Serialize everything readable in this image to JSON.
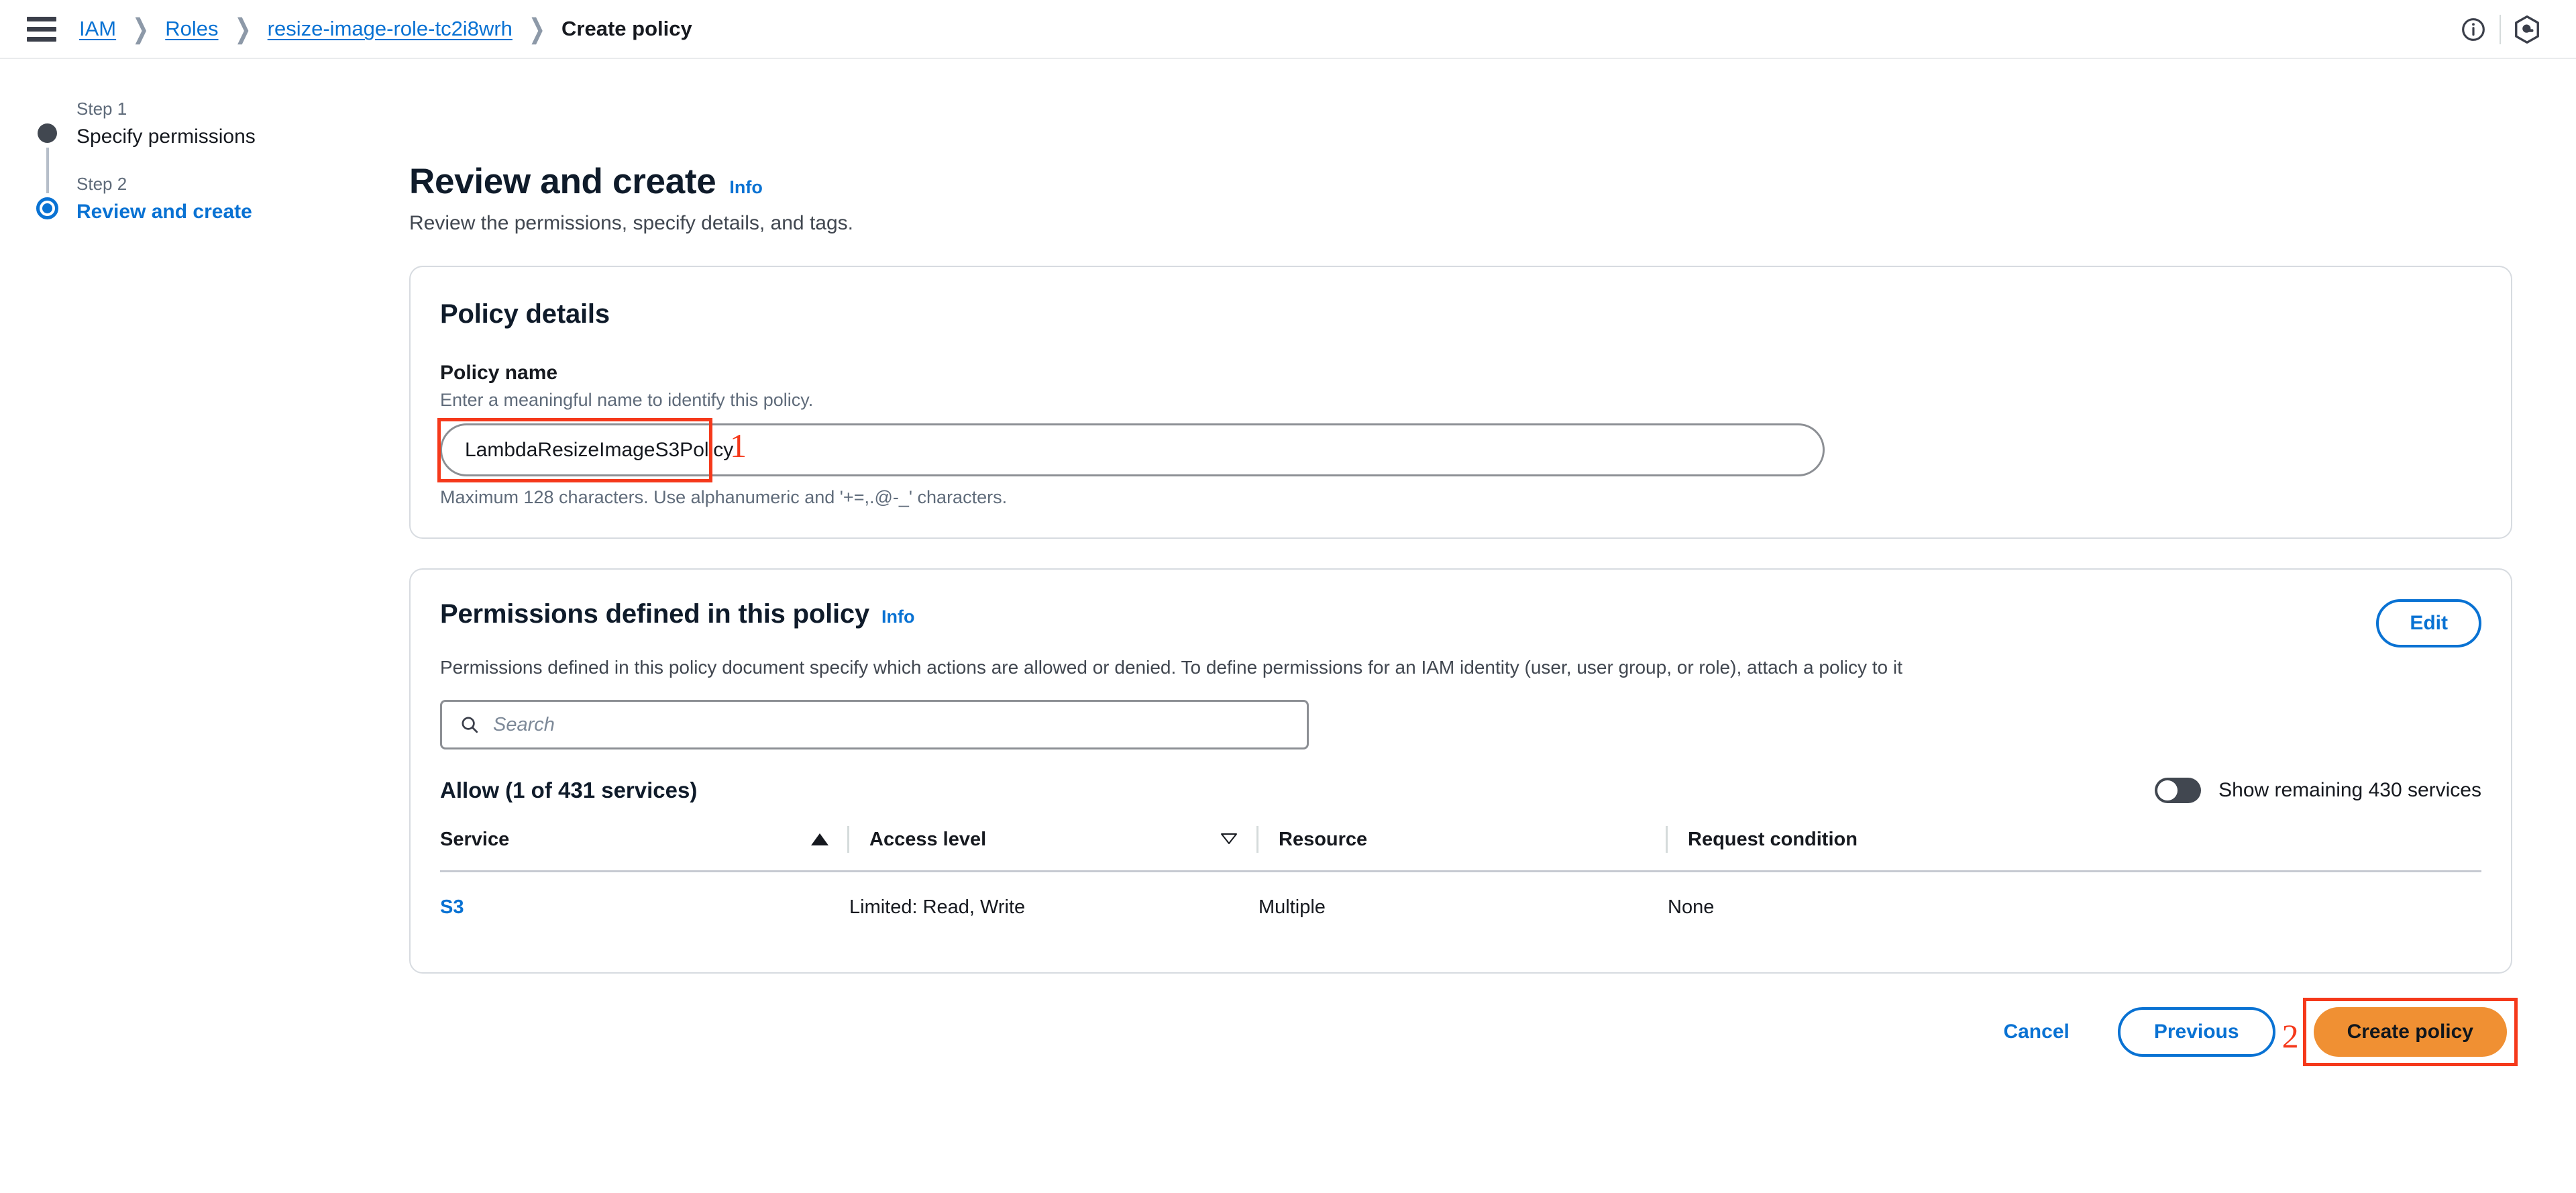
{
  "topbar": {
    "menu_icon": "hamburger-menu-icon",
    "breadcrumb": [
      {
        "label": "IAM",
        "type": "link"
      },
      {
        "label": "Roles",
        "type": "link"
      },
      {
        "label": "resize-image-role-tc2i8wrh",
        "type": "link"
      },
      {
        "label": "Create policy",
        "type": "current"
      }
    ],
    "separator": "❯",
    "info_icon": "info-circle-icon",
    "settings_icon": "aws-q-hexagon-icon"
  },
  "wizard": {
    "steps": [
      {
        "step_label": "Step 1",
        "title": "Specify permissions",
        "state": "done"
      },
      {
        "step_label": "Step 2",
        "title": "Review and create",
        "state": "active"
      }
    ]
  },
  "page": {
    "title": "Review and create",
    "info_label": "Info",
    "subtitle": "Review the permissions, specify details, and tags."
  },
  "policy_details": {
    "card_title": "Policy details",
    "field_label": "Policy name",
    "field_description": "Enter a meaningful name to identify this policy.",
    "value": "LambdaResizeImageS3Policy",
    "placeholder": "",
    "hint": "Maximum 128 characters. Use alphanumeric and '+=,.@-_' characters."
  },
  "permissions": {
    "card_title": "Permissions defined in this policy",
    "info_label": "Info",
    "edit_label": "Edit",
    "description": "Permissions defined in this policy document specify which actions are allowed or denied. To define permissions for an IAM identity (user, user group, or role), attach a policy to it",
    "search_placeholder": "Search",
    "search_value": "",
    "search_icon": "search-icon",
    "allow_heading": "Allow (1 of 431 services)",
    "toggle_label": "Show remaining 430 services",
    "toggle_state": "off",
    "columns": [
      {
        "label": "Service",
        "sort": "asc"
      },
      {
        "label": "Access level",
        "sort": "desc"
      },
      {
        "label": "Resource",
        "sort": "none"
      },
      {
        "label": "Request condition",
        "sort": "none"
      }
    ],
    "rows": [
      {
        "service": "S3",
        "access_level": "Limited: Read, Write",
        "resource": "Multiple",
        "request_condition": "None"
      }
    ]
  },
  "actions": {
    "cancel_label": "Cancel",
    "previous_label": "Previous",
    "create_label": "Create policy"
  },
  "annotations": [
    {
      "number": "1",
      "target": "policy-name-input"
    },
    {
      "number": "2",
      "target": "create-policy-button"
    }
  ],
  "colors": {
    "link_blue": "#0972d3",
    "primary_orange": "#f09033",
    "annotation_red": "#f5391b",
    "step_done": "#414750"
  }
}
